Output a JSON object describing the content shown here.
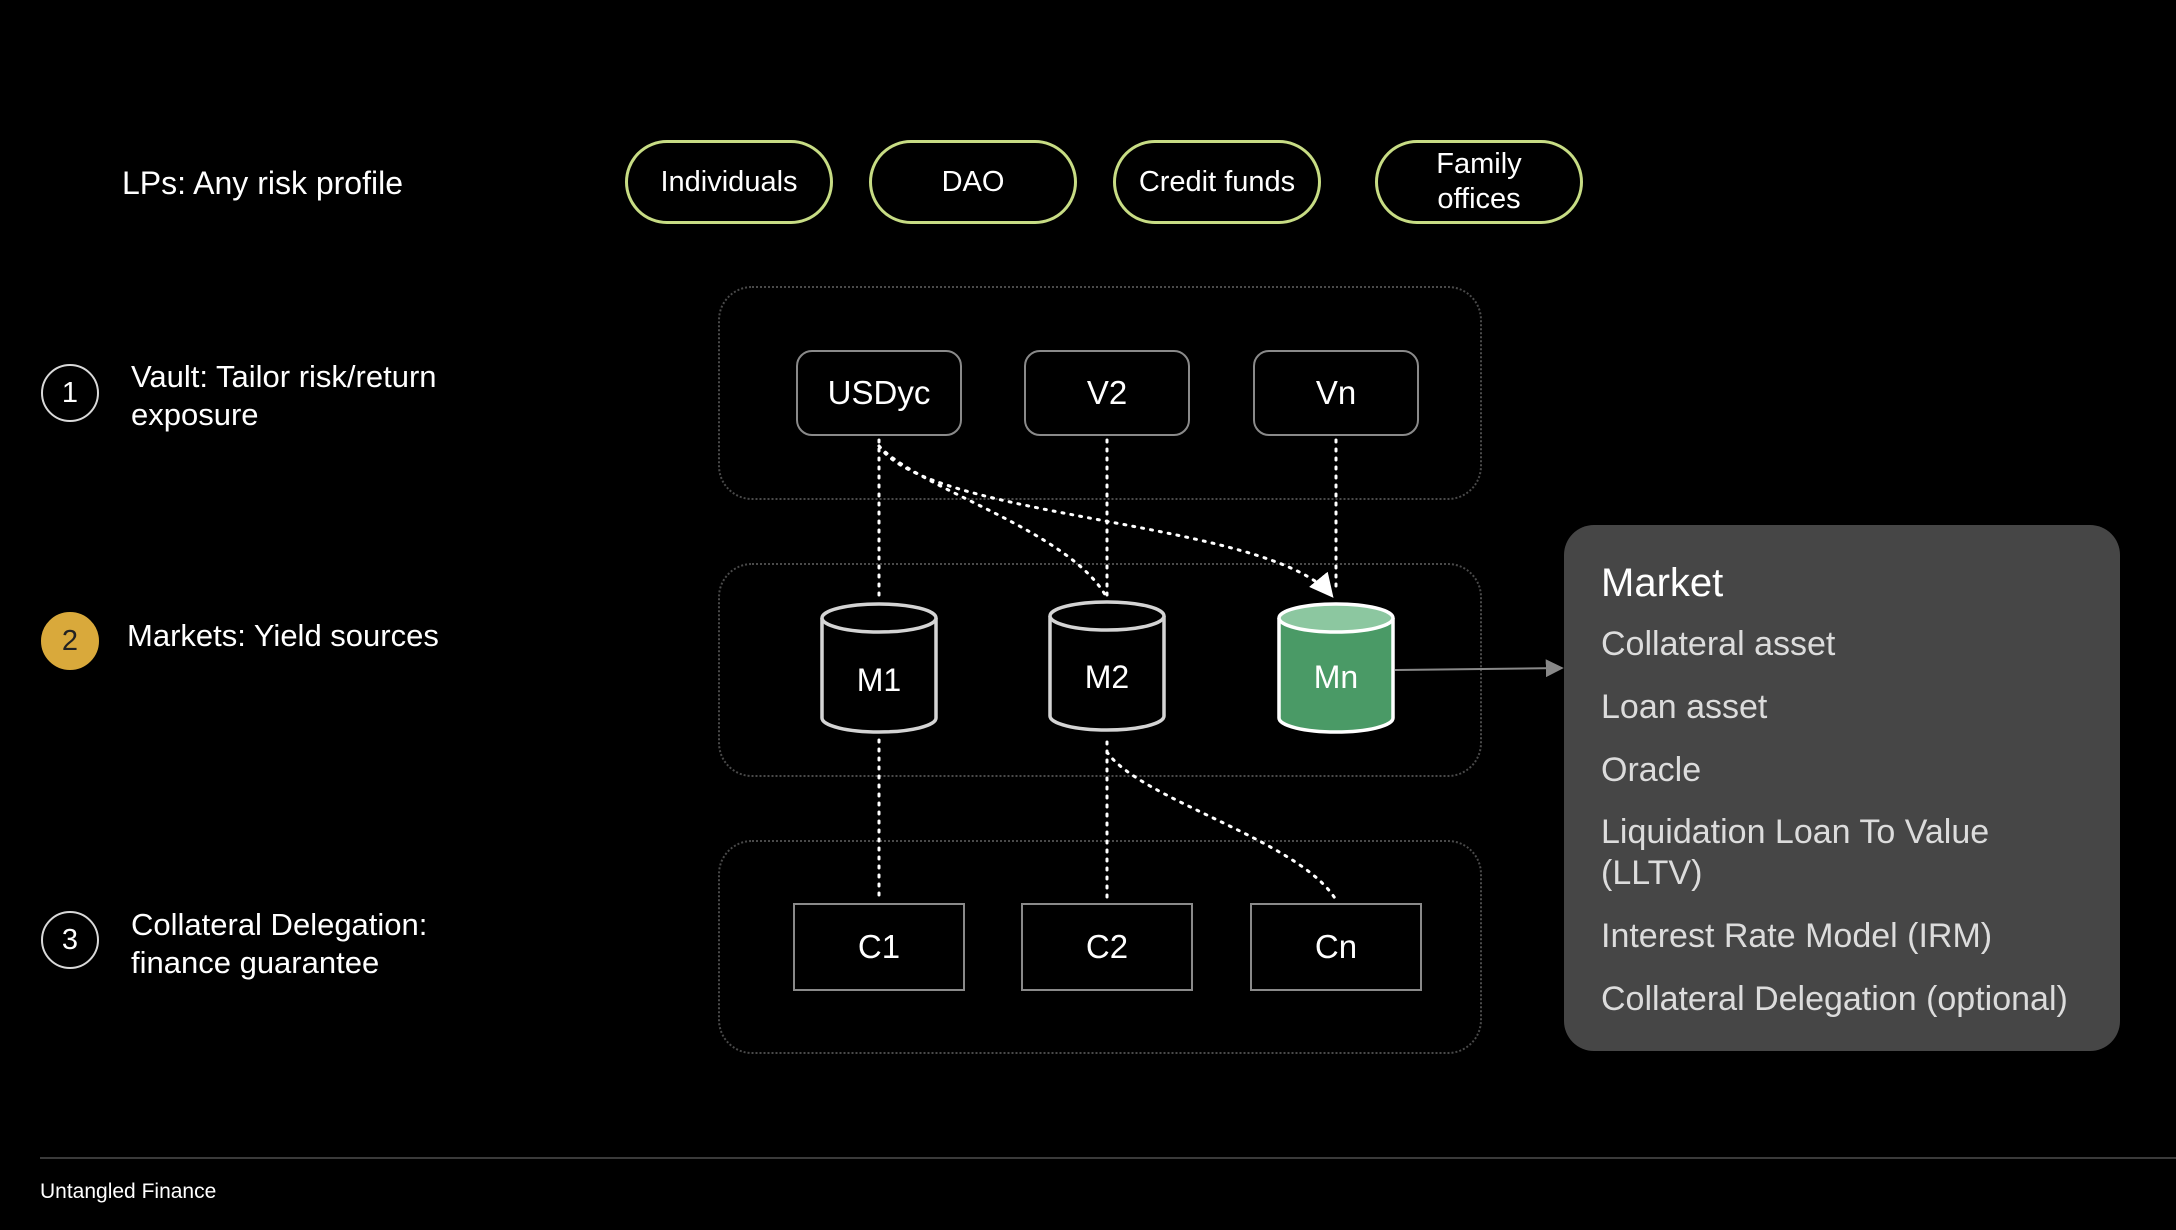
{
  "lps": {
    "label": "LPs: Any risk profile",
    "pills": [
      "Individuals",
      "DAO",
      "Credit funds",
      "Family\noffices"
    ],
    "pill_color": "#c7dc84"
  },
  "steps": [
    {
      "number": "1",
      "text": "Vault: Tailor risk/return\nexposure"
    },
    {
      "number": "2",
      "text": "Markets: Yield sources",
      "highlight_color": "#d9a93b"
    },
    {
      "number": "3",
      "text": "Collateral Delegation:\nfinance guarantee"
    }
  ],
  "vaults": [
    "USDyc",
    "V2",
    "Vn"
  ],
  "markets": [
    "M1",
    "M2",
    "Mn"
  ],
  "market_highlight_color": "#4a9a66",
  "collaterals": [
    "C1",
    "C2",
    "Cn"
  ],
  "market_panel": {
    "title": "Market",
    "items": [
      "Collateral asset",
      "Loan asset",
      "Oracle",
      "Liquidation Loan To Value\n(LLTV)",
      "Interest Rate Model (IRM)",
      "Collateral Delegation (optional)"
    ]
  },
  "footer": "Untangled Finance"
}
